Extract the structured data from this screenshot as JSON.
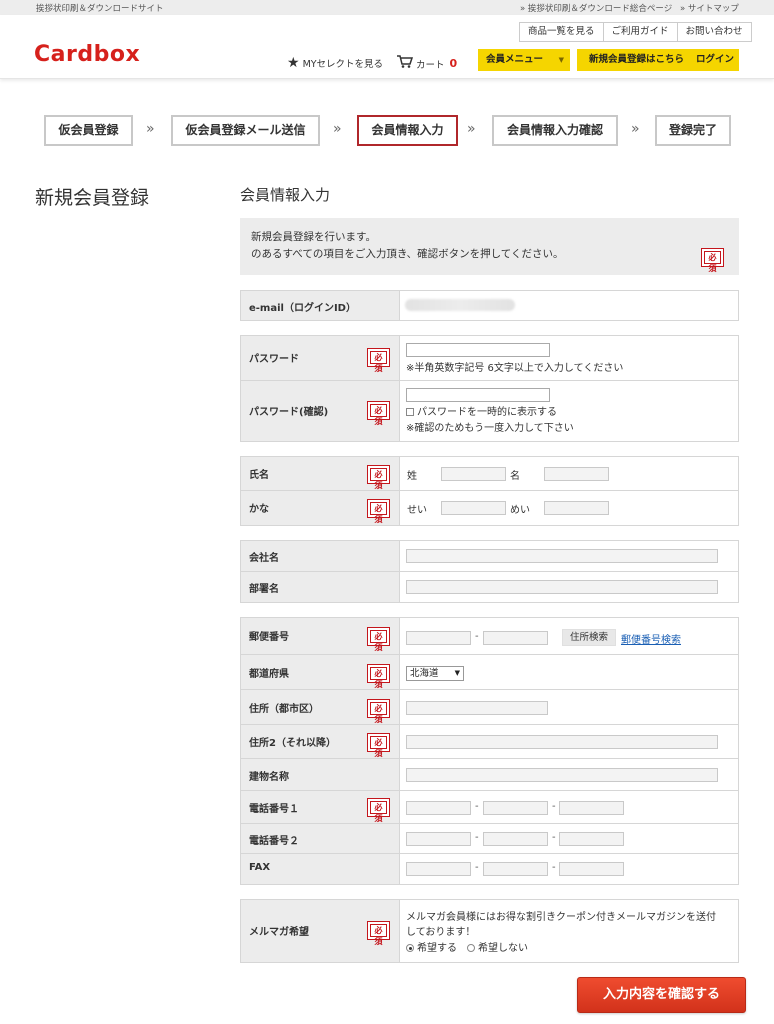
{
  "topbar": {
    "site_label": "挨拶状印刷＆ダウンロードサイト",
    "general_link": "» 挨拶状印刷＆ダウンロード総合ページ",
    "sitemap_link": "» サイトマップ"
  },
  "header": {
    "logo": "Cardbox",
    "links": [
      "商品一覧を見る",
      "ご利用ガイド",
      "お問い合わせ"
    ],
    "myselect": "MYセレクトを見る",
    "cart_label": "カート",
    "cart_count": "0",
    "member_menu": "会員メニュー",
    "register_label": "新規会員登録はこちら",
    "login_label": "ログイン"
  },
  "steps": [
    "仮会員登録",
    "仮会員登録メール送信",
    "会員情報入力",
    "会員情報入力確認",
    "登録完了"
  ],
  "step_separator": "»",
  "active_step": 2,
  "side_title": "新規会員登録",
  "section_title": "会員情報入力",
  "intro": {
    "line1": "新規会員登録を行います。",
    "line2": "のあるすべての項目をご入力頂き、確認ボタンを押してください。"
  },
  "required_label": "必須",
  "form": {
    "email_label": "e-mail（ログインID）",
    "password_label": "パスワード",
    "password_note": "※半角英数字記号 6文字以上で入力してください",
    "password_confirm_label": "パスワード(確認)",
    "show_password": "パスワードを一時的に表示する",
    "confirm_note": "※確認のためもう一度入力して下さい",
    "name_label": "氏名",
    "sei": "姓",
    "mei": "名",
    "kana_label": "かな",
    "sei_kana": "せい",
    "mei_kana": "めい",
    "company_label": "会社名",
    "department_label": "部署名",
    "zip_label": "郵便番号",
    "zip_search_button": "住所検索",
    "zip_lookup_link": "郵便番号検索",
    "pref_label": "都道府県",
    "pref_value": "北海道",
    "address_label": "住所（都市区）",
    "address2_label": "住所2（それ以降）",
    "building_label": "建物名称",
    "phone1_label": "電話番号１",
    "phone2_label": "電話番号２",
    "fax_label": "FAX",
    "dash": "-",
    "newsletter_label": "メルマガ希望",
    "newsletter_text1": "メルマガ会員様にはお得な割引きクーポン付きメールマガジンを送付",
    "newsletter_text2": "しております！",
    "opt_in": "希望する",
    "opt_out": "希望しない"
  },
  "confirm_button": "入力内容を確認する",
  "colors": {
    "brand_red": "#d6211c",
    "accent_yellow": "#f5d500",
    "required_red": "#c4161c",
    "link_blue": "#1a5fb4"
  }
}
